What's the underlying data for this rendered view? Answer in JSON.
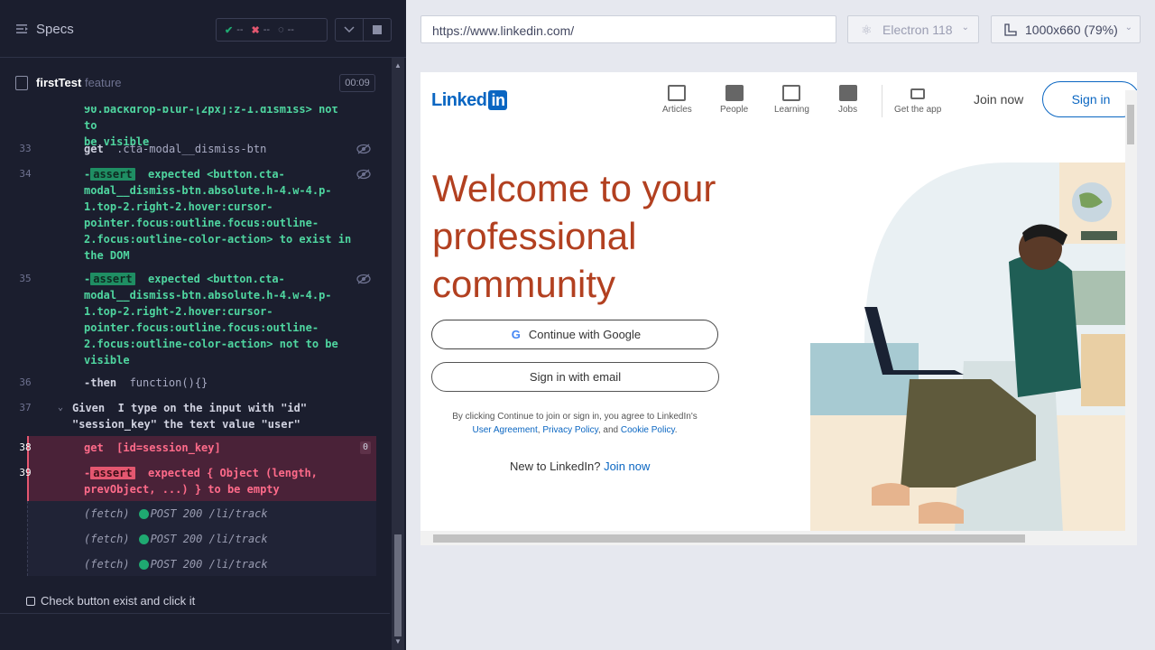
{
  "sidebar": {
    "title": "Specs",
    "stats": {
      "passed": "--",
      "failed": "--",
      "pending": "--"
    },
    "file": {
      "name": "firstTest",
      "tag": "feature",
      "timer": "00:09"
    },
    "bottom_label": "Check button exist and click it"
  },
  "log": {
    "top_cut": "90.backdrop-blur-[2px]:z-1.dismiss> not to\nbe visible",
    "rows": [
      {
        "num": "33",
        "cmd": "get",
        "arg": ".cta-modal__dismiss-btn"
      },
      {
        "num": "34",
        "cmd": "assert",
        "text": "expected <button.cta-\nmodal__dismiss-btn.absolute.h-4.w-4.p-\n1.top-2.right-2.hover:cursor-\npointer.focus:outline.focus:outline-\n2.focus:outline-color-action> to exist in\nthe DOM"
      },
      {
        "num": "35",
        "cmd": "assert",
        "text": "expected <button.cta-\nmodal__dismiss-btn.absolute.h-4.w-4.p-\n1.top-2.right-2.hover:cursor-\npointer.focus:outline.focus:outline-\n2.focus:outline-color-action> not to be\nvisible"
      },
      {
        "num": "36",
        "cmd": "-then",
        "arg": "function(){}"
      },
      {
        "num": "37",
        "cmd": "Given",
        "text": "I type on the input with \"id\"\n\"session_key\" the text value \"user\""
      },
      {
        "num": "38",
        "cmd": "get",
        "arg": "[id=session_key]",
        "badge": "0"
      },
      {
        "num": "39",
        "cmd": "assert",
        "text": "expected { Object (length,\nprevObject, ...) } to be empty"
      }
    ],
    "fetch": [
      {
        "label": "(fetch)",
        "req": "POST 200 /li/track"
      },
      {
        "label": "(fetch)",
        "req": "POST 200 /li/track"
      },
      {
        "label": "(fetch)",
        "req": "POST 200 /li/track"
      }
    ]
  },
  "aut": {
    "url": "https://www.linkedin.com/",
    "browser": "Electron 118",
    "viewport": "1000x660  (79%)"
  },
  "page": {
    "logo": "Linked",
    "logo_in": "in",
    "nav": [
      "Articles",
      "People",
      "Learning",
      "Jobs",
      "Get the app"
    ],
    "join_now": "Join now",
    "sign_in": "Sign in",
    "headline": "Welcome to your professional community",
    "google_btn": "Continue with Google",
    "email_btn": "Sign in with email",
    "terms_pre": "By clicking Continue to join or sign in, you agree to LinkedIn's ",
    "terms_ua": "User Agreement",
    "terms_mid": ", ",
    "terms_pp": "Privacy Policy",
    "terms_and": ", and ",
    "terms_cp": "Cookie Policy",
    "terms_end": ".",
    "new_to": "New to LinkedIn? ",
    "new_join": "Join now"
  },
  "colors": {
    "accent": "#0a66c2",
    "headline": "#b24020",
    "pass": "#1fa971",
    "fail": "#e45770"
  }
}
